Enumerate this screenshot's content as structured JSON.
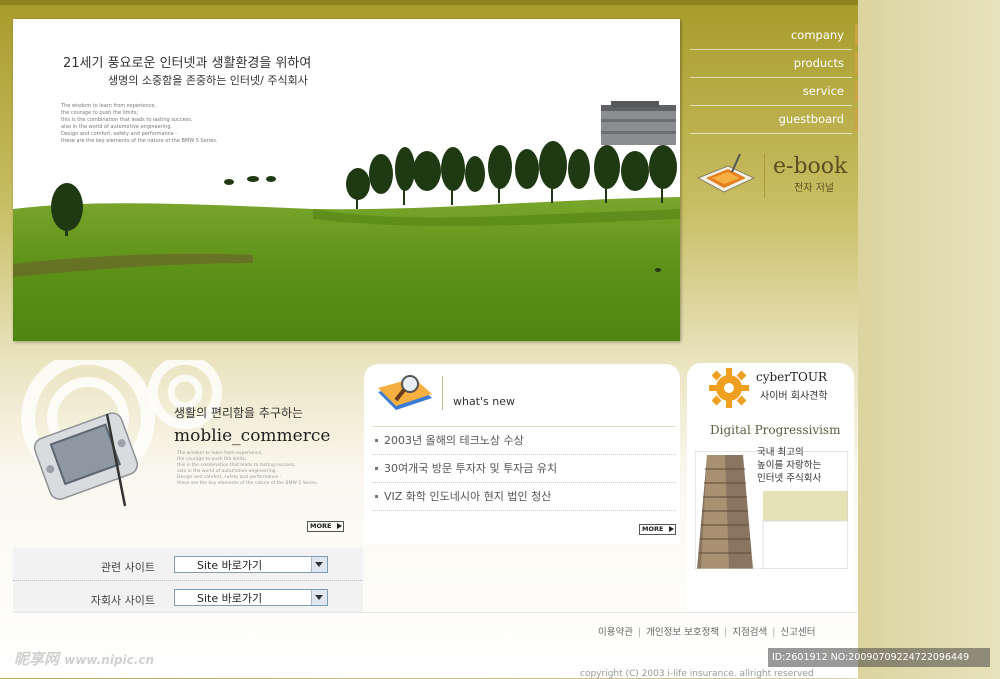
{
  "hero": {
    "headline": "21세기 풍요로운 인터넷과 생활환경을 위하여",
    "subline": "생명의 소중함을 존중하는 인터넷/ 주식회사",
    "small_text": [
      "The wisdom to learn from experience,",
      "the courage to push the limits;",
      "this is the combination that leads to lasting success,",
      "also in the world of automotive engineering.",
      "Design and comfort, safety and performance -",
      "these are the key elements of the nature of the BMW 5 Series."
    ]
  },
  "nav": {
    "items": [
      {
        "label": "company"
      },
      {
        "label": "products"
      },
      {
        "label": "service"
      },
      {
        "label": "guestboard"
      }
    ]
  },
  "ebook": {
    "title": "e-book",
    "subtitle": "전자 저널",
    "icon": "ebook-icon"
  },
  "mobile_commerce": {
    "subtitle": "생활의 편리함을 추구하는",
    "title": "moblie_commerce",
    "small_text": [
      "The wisdom to learn from experience,",
      "the courage to push the limits;",
      "this is the combination that leads to lasting success,",
      "also in the world of automotive engineering.",
      "Design and comfort, safety and performance -",
      "these are the key elements of the nature of the BMW 5 Series."
    ],
    "more_label": "MORE",
    "icon": "pda-icon"
  },
  "related_sites": {
    "rows": [
      {
        "label": "관련 사이트",
        "value": "Site 바로가기"
      },
      {
        "label": "자회사 사이트",
        "value": "Site 바로가기"
      }
    ]
  },
  "whats_new": {
    "title": "what's new",
    "icon": "magnifier-folder-icon",
    "items": [
      "2003년 올해의 테크노상 수상",
      "30여개국 방문 투자자 및 투자금 유치",
      "VIZ 화학 인도네시아 현지 법인 청산"
    ],
    "more_label": "MORE"
  },
  "cyber_tour": {
    "title": "cyberTOUR",
    "subtitle": "사이버 회사견학",
    "tagline": "Digital Progressivism",
    "description": [
      "국내 최고의",
      "높이를 자랑하는",
      "인터넷 주식회사"
    ],
    "icon": "gear-icon"
  },
  "footer": {
    "links": [
      "이용약관",
      "개인정보 보호정책",
      "지점검색",
      "신고센터"
    ],
    "copyright": "copyright (C) 2003 i-life insurance. allright reserved"
  },
  "watermark": {
    "left_text": "昵享网",
    "left_url": "www.nipic.cn",
    "right_text": "ID:2601912 NO:20090709224722096449"
  },
  "colors": {
    "olive": "#a89b2c",
    "accent": "#c9a345",
    "grass": "#6a9e1e"
  }
}
